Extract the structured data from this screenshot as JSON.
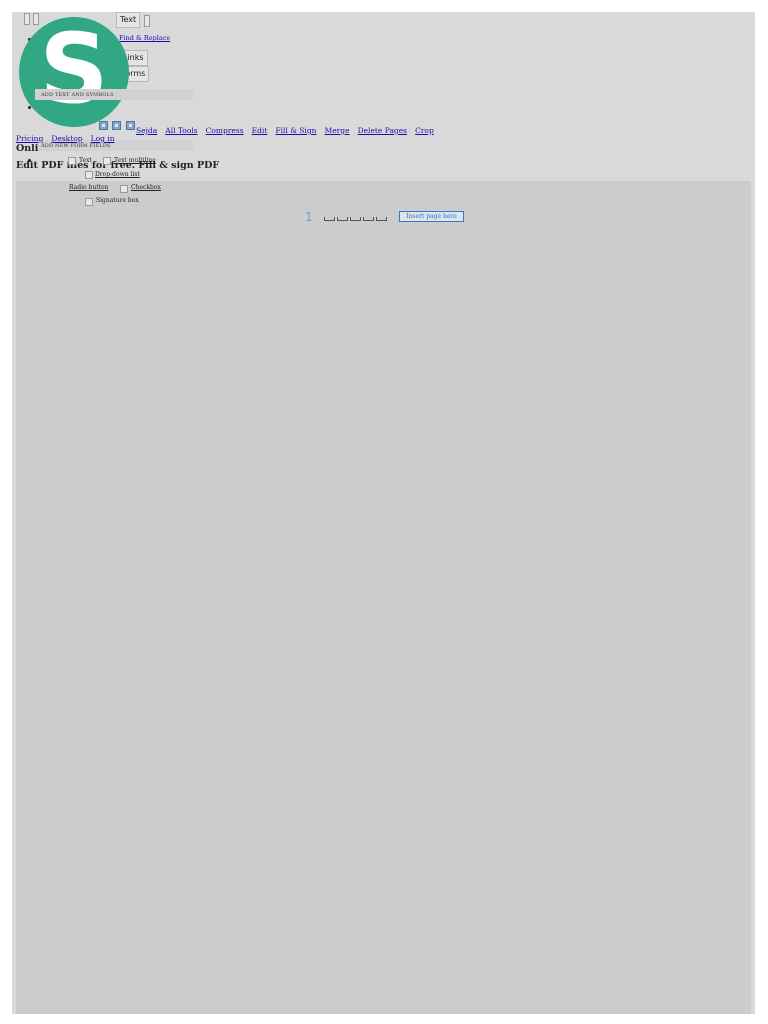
{
  "toolbar": {
    "tools_text": "Text",
    "find_replace": "Find & Replace",
    "links": "Links",
    "forms": "Forms"
  },
  "panel": {
    "add_text_symbols": "ADD TEXT AND SYMBOLS",
    "add_form_fields": "ADD NEW FORM FIELDS",
    "fields": {
      "text": "Text",
      "text_multiline": "Text multiline",
      "dropdown": "Drop-down list",
      "radio": "Radio button",
      "checkbox": "Checkbox",
      "signature": "Signature box"
    }
  },
  "nav": {
    "pricing": "Pricing",
    "desktop": "Desktop",
    "login": "Log in",
    "sejda": "Sejda",
    "all_tools": "All Tools",
    "compress": "Compress",
    "edit": "Edit",
    "fill_sign": "Fill & Sign",
    "merge": "Merge",
    "delete_pages": "Delete Pages",
    "crop": "Crop"
  },
  "page": {
    "heading_partial": "Onli",
    "subheading": "Edit PDF files for free. Fill & sign PDF"
  },
  "viewer": {
    "page_number": "1",
    "insert_page": "Insert page here"
  },
  "brand": {
    "logo_letter": "S",
    "logo_color": "#31a883"
  }
}
